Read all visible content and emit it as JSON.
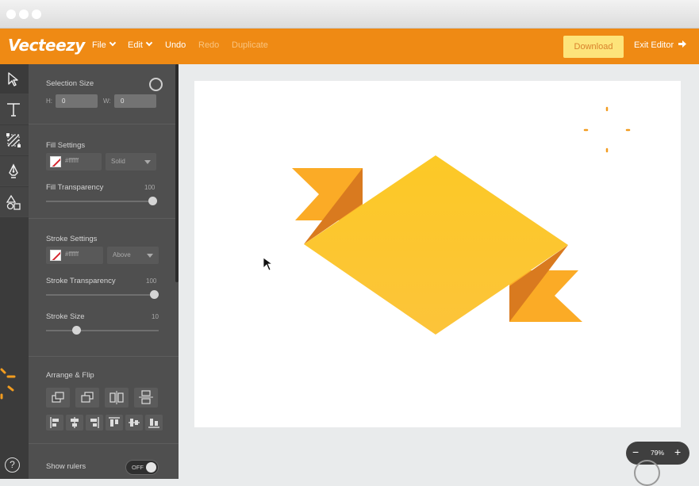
{
  "app": {
    "logo": "Vecteezy",
    "brand_color": "#ef8a14"
  },
  "menu": {
    "file": "File",
    "edit": "Edit",
    "undo": "Undo",
    "redo": "Redo",
    "duplicate": "Duplicate",
    "download": "Download",
    "exit": "Exit Editor"
  },
  "tools": [
    "pointer-icon",
    "text-icon",
    "transform-icon",
    "pen-icon",
    "shapes-icon"
  ],
  "panel": {
    "selection": {
      "title": "Selection Size",
      "h_label": "H:",
      "h_value": "0",
      "w_label": "W:",
      "w_value": "0"
    },
    "fill": {
      "title": "Fill Settings",
      "color": "#ffffff",
      "mode": "Solid",
      "transparency_label": "Fill Transparency",
      "transparency_value": "100"
    },
    "stroke": {
      "title": "Stroke Settings",
      "color": "#ffffff",
      "position": "Above",
      "transparency_label": "Stroke Transparency",
      "transparency_value": "100",
      "size_label": "Stroke Size",
      "size_value": "10"
    },
    "arrange": {
      "title": "Arrange & Flip"
    },
    "rulers": {
      "label": "Show rulers",
      "state": "OFF"
    }
  },
  "zoom": {
    "minus": "−",
    "value": "79%",
    "plus": "+"
  },
  "artwork": {
    "ribbon_light": "#fcc52a",
    "ribbon_mid": "#fbab26",
    "ribbon_dark": "#d97a1f",
    "spark_color": "#f29c1f"
  }
}
